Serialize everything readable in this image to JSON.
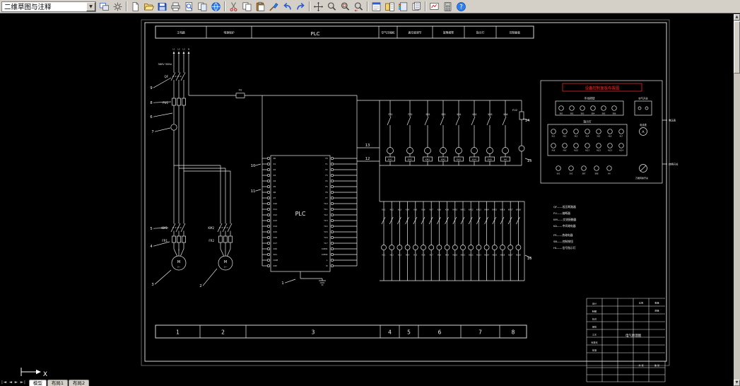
{
  "toolbar": {
    "workspace": "二维草图与注释",
    "groups": [
      [
        "workspace",
        "workspace-settings"
      ],
      [
        "qnew",
        "open",
        "save",
        "plot",
        "plot-preview",
        "publish",
        "etransmit"
      ],
      [
        "cut",
        "copy",
        "paste",
        "match-properties",
        "undo",
        "redo"
      ],
      [
        "pan",
        "zoom-realtime",
        "zoom-window",
        "zoom-previous"
      ],
      [
        "properties",
        "design-center",
        "tool-palettes",
        "sheet-set"
      ],
      [
        "markup",
        "quick-calc",
        "help"
      ]
    ]
  },
  "canvas": {
    "header_cells": [
      "主电路",
      "电源保护",
      "PLC",
      "空气压缩机",
      "真空度调节",
      "故障报警",
      "指示灯",
      "控制面板"
    ],
    "supply": {
      "voltage": "380V 50Hz",
      "phases": [
        "L1",
        "L2",
        "L3",
        "N"
      ],
      "labels": {
        "qf": "QF",
        "fu_row": "FU1",
        "fu_feed": "FU",
        "fu_ctrl": "FU2",
        "km1": "KM1",
        "km2": "KM2",
        "fr1": "FR1",
        "fr2": "FR2",
        "motor": "M",
        "motor_sub": "3~"
      }
    },
    "plc": {
      "label": "PLC",
      "left": [
        "X0",
        "X1",
        "X2",
        "X3",
        "X4",
        "X5",
        "X6",
        "X7",
        "X10",
        "X11",
        "X12",
        "X13",
        "X14",
        "X15",
        "X16",
        "X17",
        "X20",
        "X21",
        "COM",
        "24V"
      ],
      "right": [
        "Y0",
        "Y1",
        "Y2",
        "Y3",
        "Y4",
        "Y5",
        "Y6",
        "Y7",
        "Y10",
        "Y11",
        "Y12",
        "Y13",
        "Y14",
        "Y15",
        "Y16",
        "Y17",
        "COM1",
        "COM2",
        "L",
        "N"
      ]
    },
    "control": {
      "top_labels": [
        "FR1",
        "FR2",
        "SB1",
        "SB2",
        "KA1",
        "KA2",
        "KA3",
        "KA4"
      ],
      "coil_labels": [
        "KA1",
        "KA2",
        "KM1",
        "KM2",
        "KA3",
        "KA4",
        "KA5",
        "HA"
      ]
    },
    "lamps": {
      "contact_labels": [
        "KA1",
        "KA2",
        "KA3",
        "KA4",
        "KA5",
        "KA6",
        "KA7",
        "KA8",
        "KA9",
        "KA10",
        "KA11",
        "KA12",
        "KA13",
        "KA14",
        "KA15",
        "KA16",
        "KA17",
        "KA18"
      ],
      "lamp_labels": [
        "HL1",
        "HL2",
        "HL3",
        "HL4",
        "HL5",
        "HL6",
        "HL7",
        "HL8",
        "HL9",
        "HL10",
        "HL11",
        "HL12",
        "HL13",
        "HL14",
        "HL15",
        "HL16",
        "HL17",
        "HL18"
      ]
    },
    "panel": {
      "title": "设备控制面板布置图",
      "buttons_label": "手动按钮",
      "button_labels": [
        "SB1",
        "SB2",
        "SB3",
        "SB4",
        "SB5",
        "SB6"
      ],
      "air_switch_label": "空气开关",
      "lamps_label": "指示灯",
      "lamp_rows": [
        [
          "HL1",
          "HL2",
          "HL3",
          "HL4",
          "HL5",
          "HL6",
          "HL7"
        ],
        [
          "HL8",
          "HL9",
          "HL10",
          "HL11",
          "HL12",
          "HL13",
          "HL14"
        ]
      ],
      "ammeter_label": "电流表",
      "ammeter_symbol": "A",
      "bottom_labels": [
        "SA1",
        "SA2",
        "SB7",
        "SB8",
        "HA"
      ],
      "selector_label": "万能转换开关",
      "right_labels": [
        "电压表",
        "转换开关"
      ]
    },
    "notes": [
      "QF——低压断路器",
      "FU——熔断器",
      "KM——交流接触器",
      "KA——中间继电器",
      "FR——热继电器",
      "SB——控制按钮",
      "HL——信号指示灯"
    ],
    "zones": [
      "1",
      "2",
      "3",
      "4",
      "5",
      "6",
      "7",
      "8"
    ],
    "callouts": [
      "1",
      "2",
      "3",
      "4",
      "5",
      "6",
      "7",
      "8",
      "9",
      "10",
      "11",
      "12",
      "13",
      "14",
      "15",
      "16"
    ],
    "title_block": {
      "left_rows": [
        "设计",
        "制图",
        "校对",
        "审核",
        "工艺",
        "标准化",
        "批准"
      ],
      "cells": {
        "scale": "比例",
        "qty": "数量",
        "weight": "质量",
        "sheet_total": "共 张",
        "sheet_no": "第 张",
        "title": "电气原理图"
      }
    },
    "ucs_label": "X"
  },
  "statusbar": {
    "tabs": [
      "模型",
      "布局1",
      "布局2"
    ]
  }
}
